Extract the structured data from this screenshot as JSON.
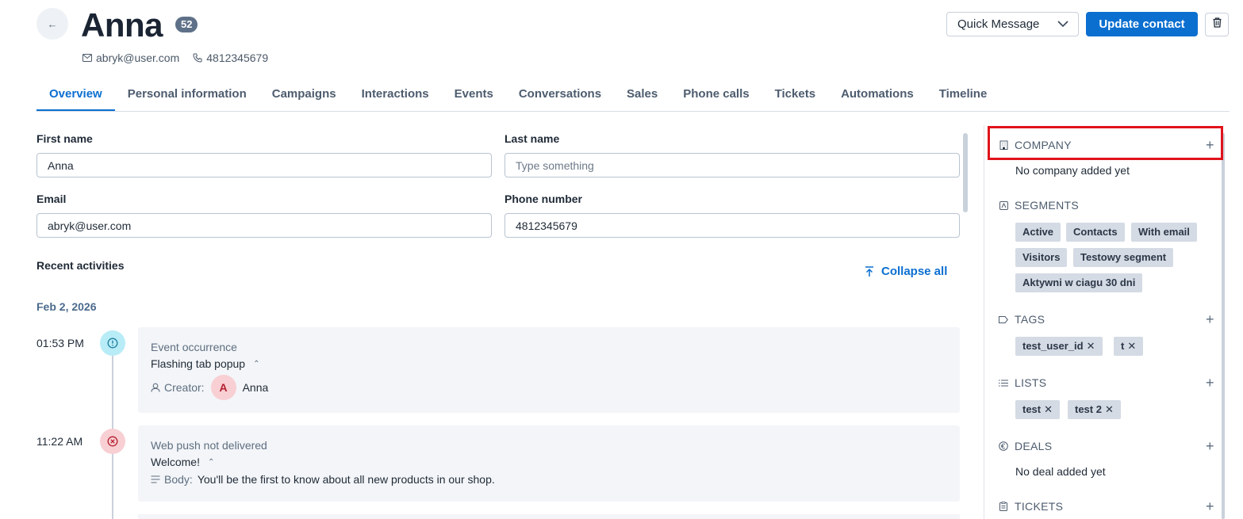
{
  "header": {
    "back_icon": "arrow-left-icon",
    "name": "Anna",
    "score": "52",
    "email": "abryk@user.com",
    "phone": "4812345679",
    "quick_message_label": "Quick Message",
    "update_label": "Update contact"
  },
  "tabs": [
    {
      "label": "Overview"
    },
    {
      "label": "Personal information"
    },
    {
      "label": "Campaigns"
    },
    {
      "label": "Interactions"
    },
    {
      "label": "Events"
    },
    {
      "label": "Conversations"
    },
    {
      "label": "Sales"
    },
    {
      "label": "Phone calls"
    },
    {
      "label": "Tickets"
    },
    {
      "label": "Automations"
    },
    {
      "label": "Timeline"
    }
  ],
  "form": {
    "first_name_label": "First name",
    "first_name_value": "Anna",
    "last_name_label": "Last name",
    "last_name_placeholder": "Type something",
    "email_label": "Email",
    "email_value": "abryk@user.com",
    "phone_label": "Phone number",
    "phone_value": "4812345679"
  },
  "activities": {
    "title": "Recent activities",
    "collapse_label": "Collapse all",
    "date": "Feb 2, 2026",
    "items": [
      {
        "time": "01:53 PM",
        "type": "Event occurrence",
        "title": "Flashing tab popup",
        "meta_label": "Creator:",
        "avatar_letter": "A",
        "meta_value": "Anna"
      },
      {
        "time": "11:22 AM",
        "type": "Web push not delivered",
        "title": "Welcome!",
        "meta_label": "Body:",
        "meta_value": "You'll be the first to know about all new products in our shop."
      }
    ]
  },
  "sidebar": {
    "company": {
      "title": "COMPANY",
      "empty": "No company added yet"
    },
    "segments": {
      "title": "SEGMENTS",
      "items": [
        "Active",
        "Contacts",
        "With email",
        "Visitors",
        "Testowy segment",
        "Aktywni w ciagu 30 dni"
      ]
    },
    "tags": {
      "title": "TAGS",
      "items": [
        "test_user_id",
        "t"
      ]
    },
    "lists": {
      "title": "LISTS",
      "items": [
        "test",
        "test 2"
      ]
    },
    "deals": {
      "title": "DEALS",
      "empty": "No deal added yet"
    },
    "tickets": {
      "title": "TICKETS"
    }
  },
  "colors": {
    "accent": "#0b6fd0",
    "highlight": "#e0131b"
  }
}
